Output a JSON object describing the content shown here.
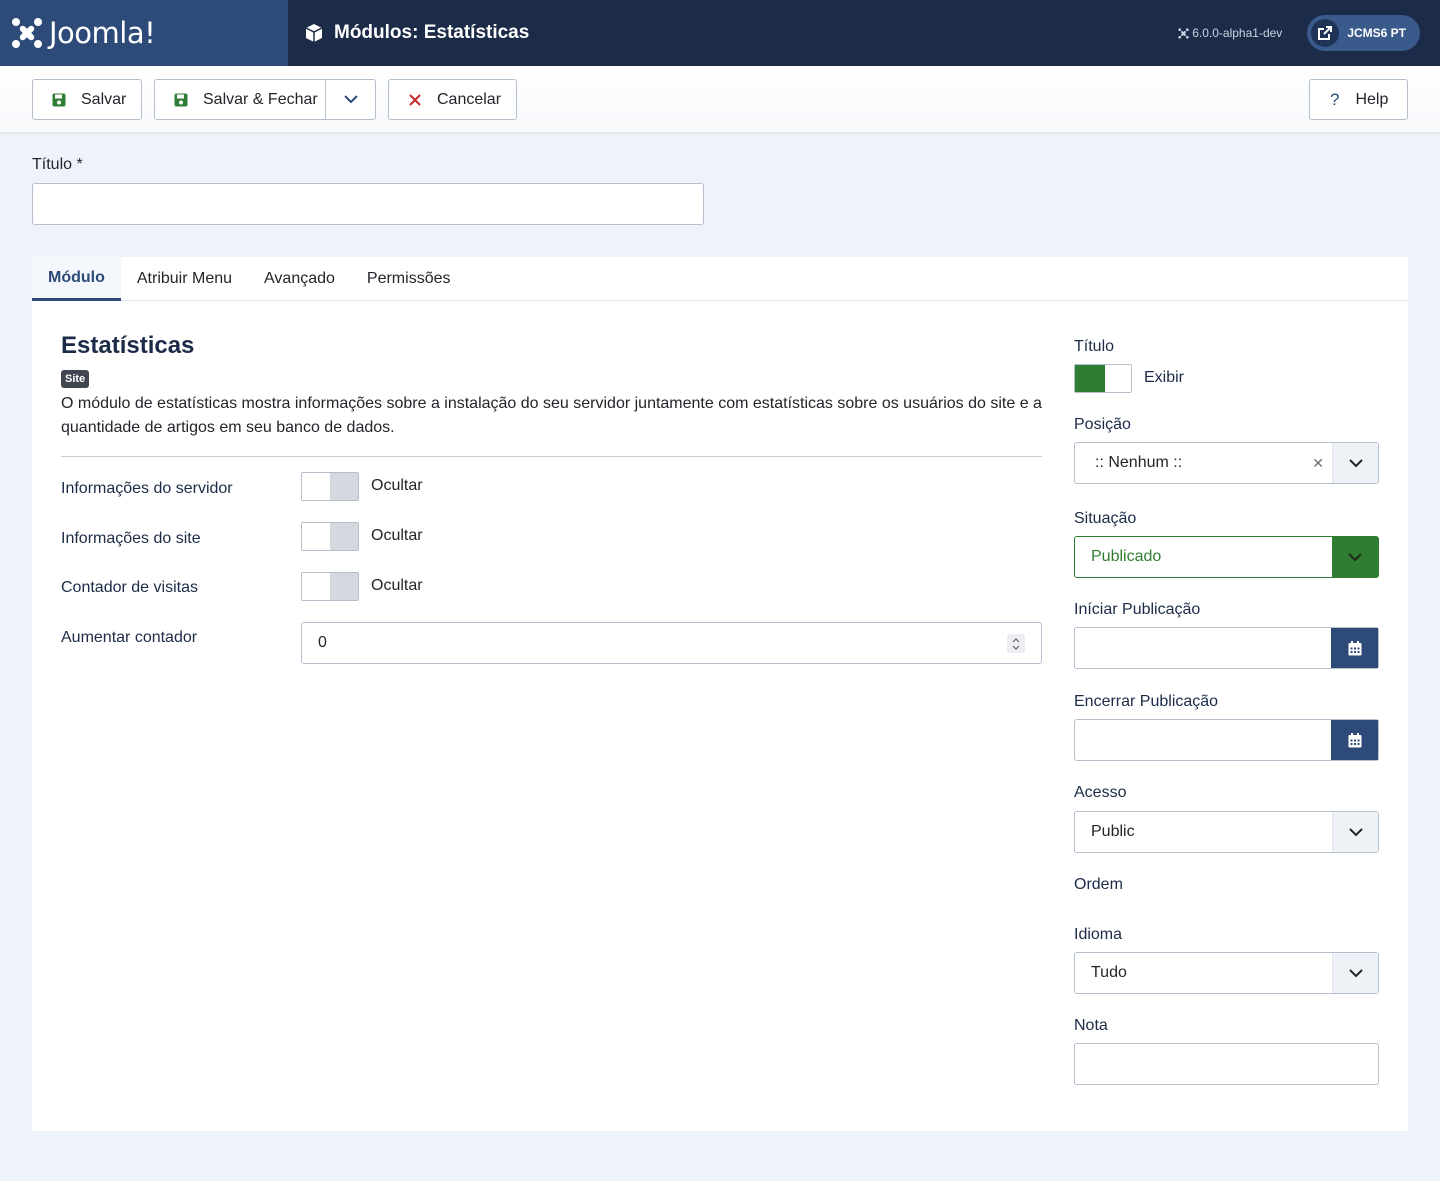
{
  "header": {
    "brand": "Joomla!",
    "page_title": "Módulos: Estatísticas",
    "version": "6.0.0-alpha1-dev",
    "user_label": "JCMS6 PT",
    "colors": {
      "header_bg": "#1c2b47",
      "brand_bg": "#2d4a78"
    }
  },
  "toolbar": {
    "save_label": "Salvar",
    "save_close_label": "Salvar & Fechar",
    "cancel_label": "Cancelar",
    "help_label": "Help"
  },
  "title_field": {
    "label": "Título *",
    "value": ""
  },
  "tabs": [
    {
      "label": "Módulo",
      "active": true
    },
    {
      "label": "Atribuir Menu",
      "active": false
    },
    {
      "label": "Avançado",
      "active": false
    },
    {
      "label": "Permissões",
      "active": false
    }
  ],
  "module": {
    "title": "Estatísticas",
    "badge": "Site",
    "description": "O módulo de estatísticas mostra informações sobre a instalação do seu servidor juntamente com estatísticas sobre os usuários do site e a quantidade de artigos em seu banco de dados."
  },
  "options": [
    {
      "label": "Informações do servidor",
      "state": "Ocultar"
    },
    {
      "label": "Informações do site",
      "state": "Ocultar"
    },
    {
      "label": "Contador de visitas",
      "state": "Ocultar"
    }
  ],
  "counter": {
    "label": "Aumentar contador",
    "value": "0"
  },
  "sidebar": {
    "title_label": "Título",
    "title_state": "Exibir",
    "position_label": "Posição",
    "position_value": ":: Nenhum ::",
    "status_label": "Situação",
    "status_value": "Publicado",
    "publish_up_label": "Iníciar Publicação",
    "publish_down_label": "Encerrar Publicação",
    "access_label": "Acesso",
    "access_value": "Public",
    "order_label": "Ordem",
    "language_label": "Idioma",
    "language_value": "Tudo",
    "note_label": "Nota",
    "colors": {
      "published": "#2f7d32",
      "calendar_btn": "#2d4a78"
    }
  },
  "icons": [
    "joomla-logo-icon",
    "module-box-icon",
    "joomla-mini-icon",
    "external-link-icon",
    "save-icon",
    "chevron-down-icon",
    "close-icon",
    "help-icon",
    "calendar-icon",
    "clear-icon",
    "spinner-icon"
  ]
}
